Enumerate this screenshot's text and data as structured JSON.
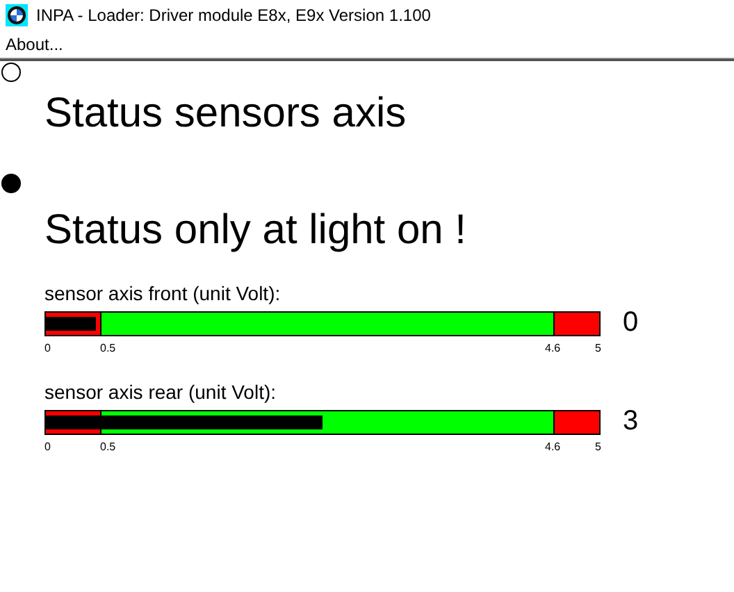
{
  "window": {
    "title": "INPA - Loader:  Driver module E8x, E9x Version 1.100"
  },
  "menu": [
    "About..."
  ],
  "indicators": [
    {
      "label": "Status sensors axis",
      "on": false
    },
    {
      "label": "Status only at light on !",
      "on": true
    }
  ],
  "gauges": [
    {
      "label": "sensor axis front (unit Volt):",
      "level": 0.09,
      "reading": "0",
      "ticks": [
        "0",
        "0.5",
        "4.6",
        "5"
      ]
    },
    {
      "label": "sensor axis rear (unit Volt):",
      "level": 0.5,
      "reading": "3",
      "ticks": [
        "0",
        "0.5",
        "4.6",
        "5"
      ]
    }
  ]
}
